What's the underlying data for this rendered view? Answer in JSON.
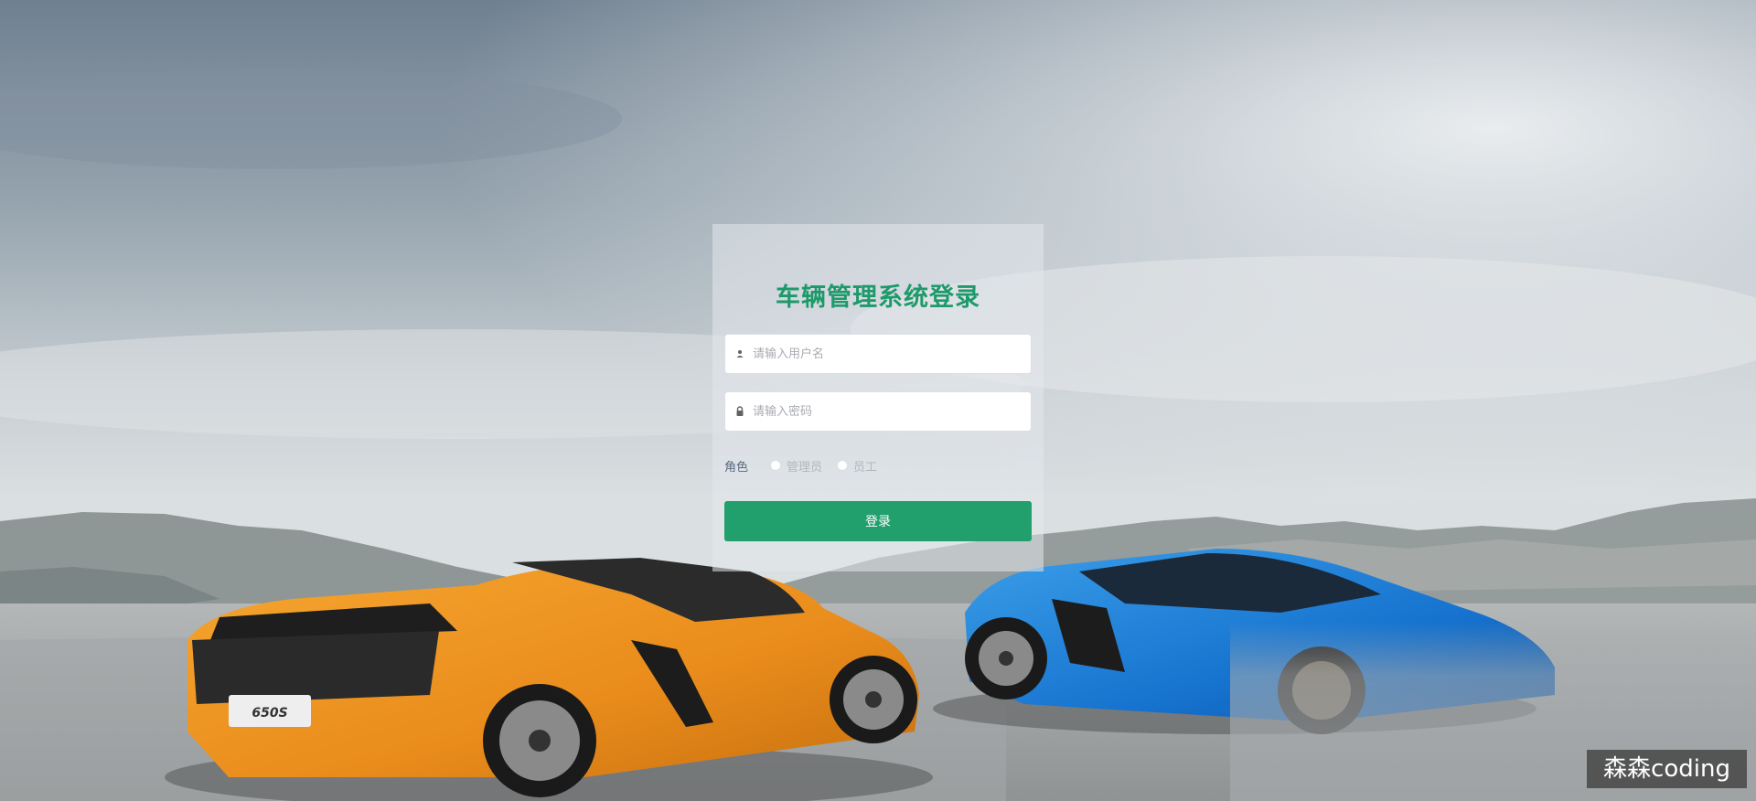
{
  "login": {
    "title": "车辆管理系统登录",
    "username_placeholder": "请输入用户名",
    "password_placeholder": "请输入密码",
    "role_label": "角色",
    "roles": [
      "管理员",
      "员工"
    ],
    "submit_label": "登录"
  },
  "watermark": {
    "text": "森森coding"
  },
  "background": {
    "car_left_badge": "650S"
  },
  "colors": {
    "accent": "#21a06e",
    "title": "#1e9a6a"
  }
}
